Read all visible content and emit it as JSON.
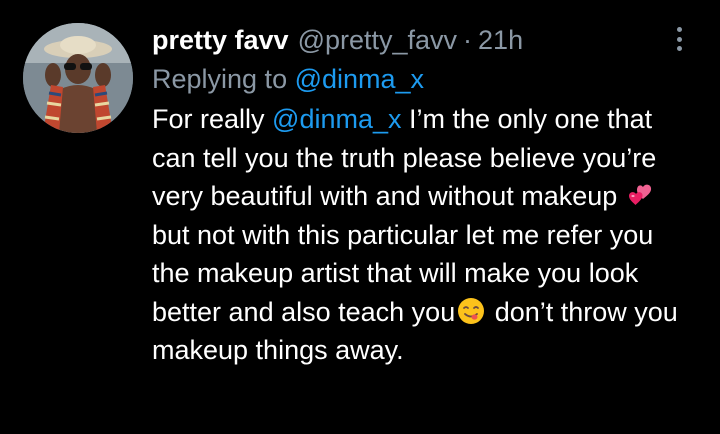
{
  "tweet": {
    "display_name": "pretty favv",
    "handle": "@pretty_favv",
    "separator": "·",
    "time": "21h",
    "replying_prefix": "Replying to ",
    "replying_to": "@dinma_x",
    "body": {
      "part1": "For really ",
      "mention": "@dinma_x",
      "part2": " I’m the only one that can tell you the truth please believe you’re very beautiful with and without makeup ",
      "emoji1": "two-hearts-emoji",
      "part3": " but not with this particular let me refer you the makeup artist that will make you look better and also teach you",
      "emoji2": "yum-face-emoji",
      "part4": " don’t throw you makeup things away."
    }
  },
  "colors": {
    "background": "#000000",
    "primary_text": "#ffffff",
    "secondary_text": "#8b98a5",
    "link": "#1d9bf0"
  },
  "icons": {
    "menu": "more-vertical-icon",
    "avatar": "avatar"
  }
}
